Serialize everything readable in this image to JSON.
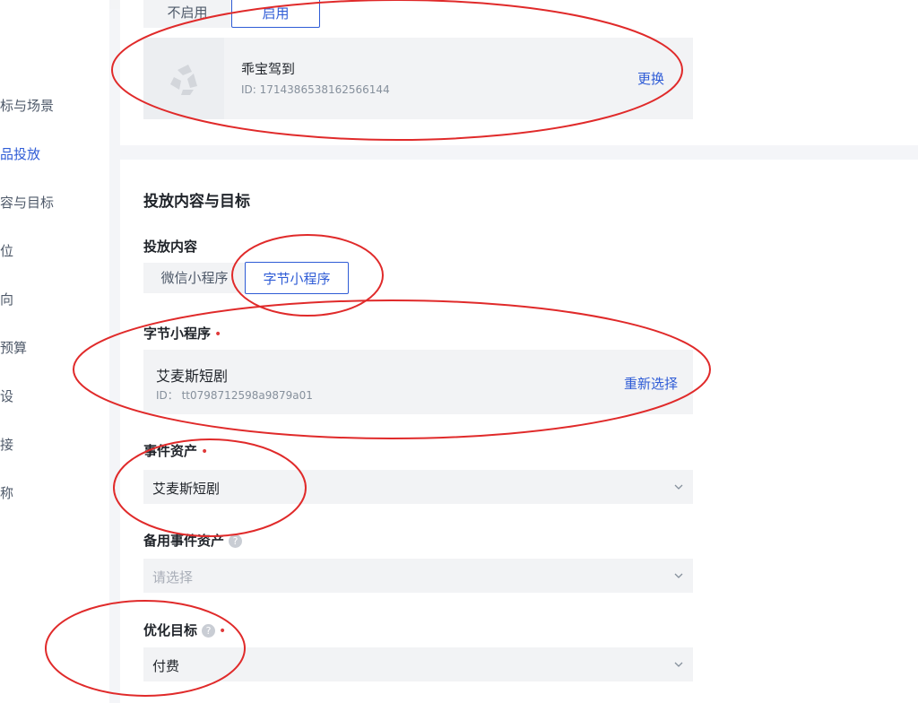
{
  "sidebar": {
    "items": [
      {
        "label": "标与场景",
        "active": false
      },
      {
        "label": "品投放",
        "active": true
      },
      {
        "label": "容与目标",
        "active": false
      },
      {
        "label": "位",
        "active": false
      },
      {
        "label": "向",
        "active": false
      },
      {
        "label": "预算",
        "active": false
      },
      {
        "label": "设",
        "active": false
      },
      {
        "label": "接",
        "active": false
      },
      {
        "label": "称",
        "active": false
      }
    ]
  },
  "top_section": {
    "toggle": {
      "off_label": "不启用",
      "on_label": "启用"
    },
    "app": {
      "name": "乖宝驾到",
      "id": "ID: 1714386538162566144",
      "action": "更换"
    }
  },
  "main_section": {
    "title": "投放内容与目标",
    "content_label": "投放内容",
    "content_tabs": [
      {
        "label": "微信小程序",
        "selected": false
      },
      {
        "label": "字节小程序",
        "selected": true
      }
    ],
    "miniprogram": {
      "label": "字节小程序",
      "required_mark": "•",
      "name": "艾麦斯短剧",
      "id": "ID：  tt0798712598a9879a01",
      "action": "重新选择"
    },
    "event_asset": {
      "label": "事件资产",
      "required_mark": "•",
      "value": "艾麦斯短剧"
    },
    "backup_event_asset": {
      "label": "备用事件资产",
      "help_icon": "?",
      "placeholder": "请选择"
    },
    "optimization_goal": {
      "label": "优化目标",
      "help_icon": "?",
      "required_mark": "•",
      "value": "付费"
    }
  },
  "annotations": {
    "color": "#e02a2a"
  },
  "colors": {
    "accent": "#2f5cd6",
    "required": "#e03a3a"
  }
}
